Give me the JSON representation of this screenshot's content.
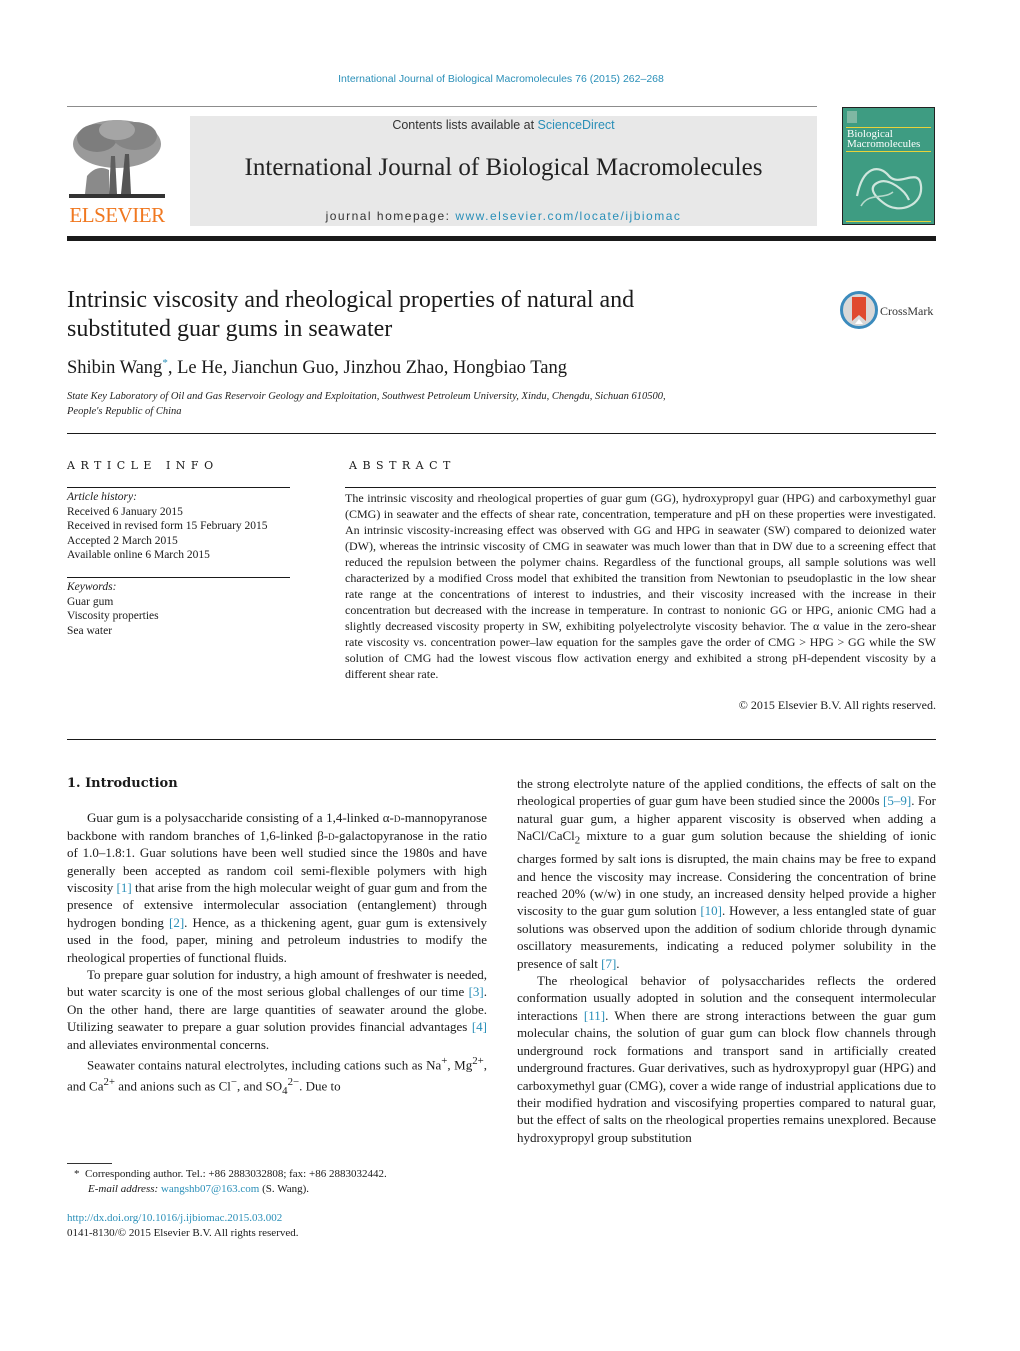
{
  "header": {
    "citation": "International Journal of Biological Macromolecules 76 (2015) 262–268",
    "contents_prefix": "Contents lists available at ",
    "contents_link": "ScienceDirect",
    "journal_title": "International Journal of Biological Macromolecules",
    "homepage_prefix": "journal homepage: ",
    "homepage_link": "www.elsevier.com/locate/ijbiomac",
    "publisher_logo_text": "ELSEVIER",
    "cover_title_line1": "Biological",
    "cover_title_line2": "Macromolecules",
    "brand_color": "#f07820",
    "link_color": "#2a8fb8",
    "cover_color": "#3e9c82"
  },
  "article": {
    "title_line1": "Intrinsic viscosity and rheological properties of natural and",
    "title_line2": "substituted guar gums in seawater",
    "crossmark_label": "CrossMark",
    "authors": [
      {
        "name": "Shibin Wang",
        "corresponding": "*"
      },
      {
        "name": "Le He"
      },
      {
        "name": "Jianchun Guo"
      },
      {
        "name": "Jinzhou Zhao"
      },
      {
        "name": "Hongbiao Tang"
      }
    ],
    "affiliation_line1": "State Key Laboratory of Oil and Gas Reservoir Geology and Exploitation, Southwest Petroleum University, Xindu, Chengdu, Sichuan 610500,",
    "affiliation_line2": "People's Republic of China"
  },
  "article_info": {
    "heading": "ARTICLE INFO",
    "history_label": "Article history:",
    "history": [
      "Received 6 January 2015",
      "Received in revised form 15 February 2015",
      "Accepted 2 March 2015",
      "Available online 6 March 2015"
    ],
    "keywords_label": "Keywords:",
    "keywords": [
      "Guar gum",
      "Viscosity properties",
      "Sea water"
    ]
  },
  "abstract": {
    "heading": "ABSTRACT",
    "text": "The intrinsic viscosity and rheological properties of guar gum (GG), hydroxypropyl guar (HPG) and carboxymethyl guar (CMG) in seawater and the effects of shear rate, concentration, temperature and pH on these properties were investigated. An intrinsic viscosity-increasing effect was observed with GG and HPG in seawater (SW) compared to deionized water (DW), whereas the intrinsic viscosity of CMG in seawater was much lower than that in DW due to a screening effect that reduced the repulsion between the polymer chains. Regardless of the functional groups, all sample solutions was well characterized by a modified Cross model that exhibited the transition from Newtonian to pseudoplastic in the low shear rate range at the concentrations of interest to industries, and their viscosity increased with the increase in their concentration but decreased with the increase in temperature. In contrast to nonionic GG or HPG, anionic CMG had a slightly decreased viscosity property in SW, exhibiting polyelectrolyte viscosity behavior. The α value in the zero-shear rate viscosity vs. concentration power–law equation for the samples gave the order of CMG > HPG > GG while the SW solution of CMG had the lowest viscous flow activation energy and exhibited a strong pH-dependent viscosity by a different shear rate.",
    "copyright": "© 2015 Elsevier B.V. All rights reserved."
  },
  "introduction": {
    "heading": "1.  Introduction",
    "p1": {
      "a": "Guar gum is a polysaccharide consisting of a 1,4-linked α-",
      "sc1": "d",
      "b": "-mannopyranose backbone with random branches of 1,6-linked β-",
      "sc2": "d",
      "c": "-galactopyranose in the ratio of 1.0–1.8:1. Guar solutions have been well studied since the 1980s and have generally been accepted as random coil semi-flexible polymers with high viscosity ",
      "ref1": "[1]",
      "d": " that arise from the high molecular weight of guar gum and from the presence of extensive intermolecular association (entanglement) through hydrogen bonding ",
      "ref2": "[2]",
      "e": ". Hence, as a thickening agent, guar gum is extensively used in the food, paper, mining and petroleum industries to modify the rheological properties of functional fluids."
    },
    "p2": {
      "a": "To prepare guar solution for industry, a high amount of freshwater is needed, but water scarcity is one of the most serious global challenges of our time ",
      "ref3": "[3]",
      "b": ". On the other hand, there are large quantities of seawater around the globe. Utilizing seawater to prepare a guar solution provides financial advantages ",
      "ref4": "[4]",
      "c": " and alleviates environmental concerns."
    },
    "p3": {
      "a": "Seawater contains natural electrolytes, including cations such as Na",
      "sup1": "+",
      "b": ", Mg",
      "sup2": "2+",
      "c": ", and Ca",
      "sup3": "2+",
      "d": " and anions such as Cl",
      "sup4": "−",
      "e": ", and SO",
      "sub5": "4",
      "sup5": "2−",
      "f": ". Due to the strong electrolyte nature of the applied conditions, the effects of salt on the rheological properties of guar gum have been studied since the 2000s ",
      "ref5": "[5–9]",
      "g": ". For natural guar gum, a higher apparent viscosity is observed when adding a NaCl/CaCl",
      "sub6": "2",
      "h": " mixture to a guar gum solution because the shielding of ionic charges formed by salt ions is disrupted, the main chains may be free to expand and hence the viscosity may increase. Considering the concentration of brine reached 20% (w/w) in one study, an increased density helped provide a higher viscosity to the guar gum solution ",
      "ref6": "[10]",
      "i": ". However, a less entangled state of guar solutions was observed upon the addition of sodium chloride through dynamic oscillatory measurements, indicating a reduced polymer solubility in the presence of salt ",
      "ref7": "[7]",
      "j": "."
    },
    "p4": {
      "a": "The rheological behavior of polysaccharides reflects the ordered conformation usually adopted in solution and the consequent intermolecular interactions ",
      "ref8": "[11]",
      "b": ". When there are strong interactions between the guar gum molecular chains, the solution of guar gum can block flow channels through underground rock formations and transport sand in artificially created underground fractures. Guar derivatives, such as hydroxypropyl guar (HPG) and carboxymethyl guar (CMG), cover a wide range of industrial applications due to their modified hydration and viscosifying properties compared to natural guar, but the effect of salts on the rheological properties remains unexplored. Because hydroxypropyl group substitution"
    }
  },
  "footnotes": {
    "corresponding_marker": "*",
    "corresponding_text": "Corresponding author. Tel.: +86 2883032808; fax: +86 2883032442.",
    "email_label": "E-mail address: ",
    "email": "wangshb07@163.com",
    "email_suffix": " (S. Wang).",
    "doi": "http://dx.doi.org/10.1016/j.ijbiomac.2015.03.002",
    "issn_copyright": "0141-8130/© 2015 Elsevier B.V. All rights reserved."
  }
}
